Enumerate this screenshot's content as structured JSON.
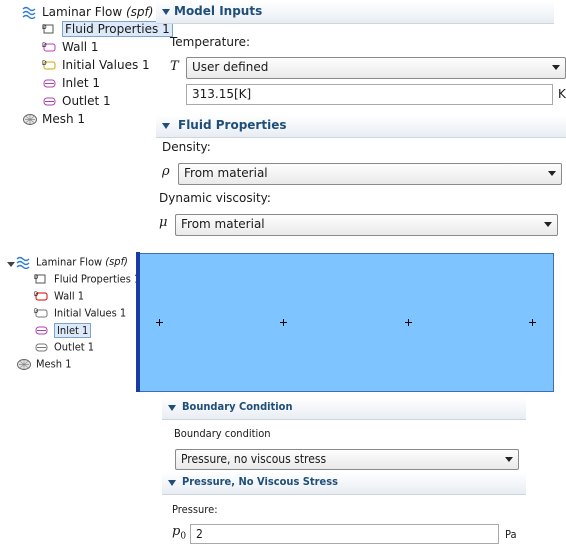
{
  "top_tree": {
    "root": {
      "label": "Laminar Flow",
      "tag": "(spf)"
    },
    "items": [
      "Fluid Properties 1",
      "Wall 1",
      "Initial Values 1",
      "Inlet 1",
      "Outlet 1"
    ],
    "mesh": "Mesh 1"
  },
  "model_inputs": {
    "title": "Model Inputs",
    "temperature_label": "Temperature:",
    "symbol": "T",
    "select_value": "User defined",
    "value": "313.15[K]",
    "unit": "K"
  },
  "fluid_properties": {
    "title": "Fluid Properties",
    "density_label": "Density:",
    "density_symbol": "ρ",
    "density_value": "From material",
    "viscosity_label": "Dynamic viscosity:",
    "viscosity_symbol": "μ",
    "viscosity_value": "From material"
  },
  "bottom_tree": {
    "root": {
      "label": "Laminar Flow",
      "tag": "(spf)"
    },
    "items": [
      "Fluid Properties 1",
      "Wall 1",
      "Initial Values 1",
      "Inlet 1",
      "Outlet 1"
    ],
    "mesh": "Mesh 1"
  },
  "boundary_condition": {
    "title": "Boundary Condition",
    "label": "Boundary condition",
    "value": "Pressure, no viscous stress"
  },
  "pressure": {
    "title": "Pressure, No Viscous Stress",
    "label": "Pressure:",
    "symbol": "p",
    "subscript": "0",
    "value": "2",
    "unit": "Pa"
  },
  "colors": {
    "geometry_fill": "#7ec4ff",
    "header_text": "#1f4e79",
    "selection": "#dce9f9"
  }
}
